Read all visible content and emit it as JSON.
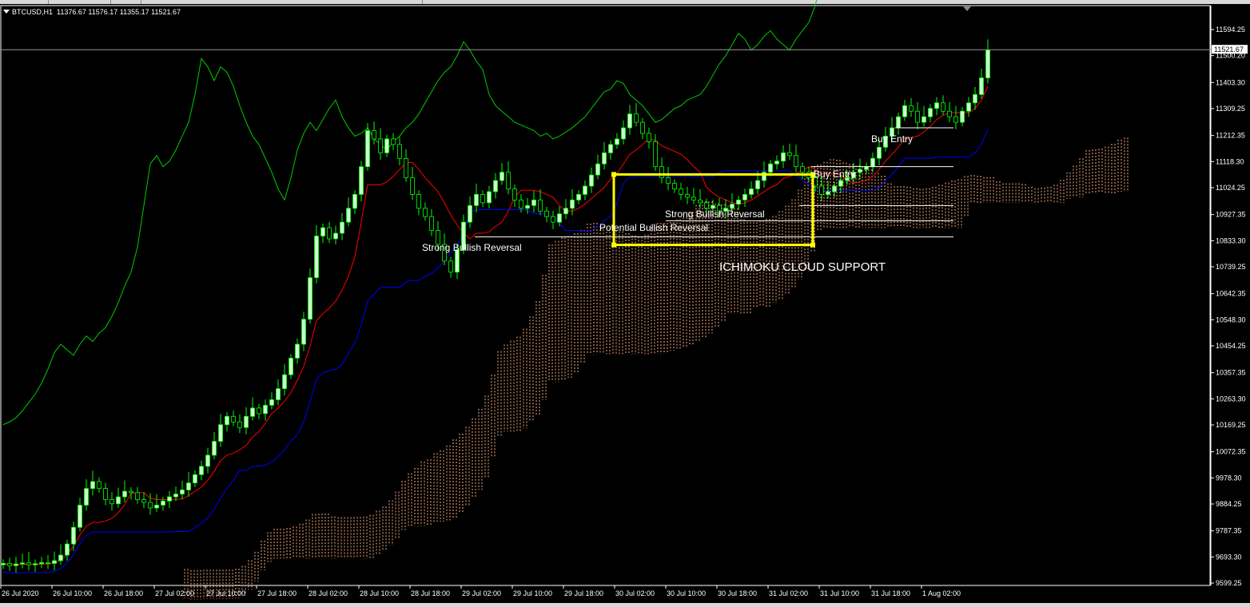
{
  "header": {
    "symbol": "BTCUSD,H1",
    "ohlc": "11376.67 11576.17 11355.17 11521.67"
  },
  "colors": {
    "background": "#000000",
    "bull_candle": "#ccffcc",
    "candle_wick": "#00ff00",
    "chikou": "#00cc00",
    "tenkan": "#ff0000",
    "kijun": "#0000ff",
    "cloud": "#ffb080",
    "highlight_box": "#ffff00",
    "level_line": "#ffffff"
  },
  "chart_data": {
    "type": "candlestick",
    "title": "BTCUSD,H1",
    "indicator": "Ichimoku",
    "current_price": "11521.67",
    "y_ticks": [
      "11594.25",
      "11500.20",
      "11403.30",
      "11309.25",
      "11212.35",
      "11118.30",
      "11024.25",
      "10927.35",
      "10833.30",
      "10739.25",
      "10642.35",
      "10548.30",
      "10454.25",
      "10357.35",
      "10263.30",
      "10169.25",
      "10072.35",
      "9978.30",
      "9884.25",
      "9787.35",
      "9693.30",
      "9599.25"
    ],
    "x_ticks": [
      "26 Jul 2020",
      "26 Jul 10:00",
      "26 Jul 18:00",
      "27 Jul 02:00",
      "27 Jul 10:00",
      "27 Jul 18:00",
      "28 Jul 02:00",
      "28 Jul 10:00",
      "28 Jul 18:00",
      "29 Jul 02:00",
      "29 Jul 10:00",
      "29 Jul 18:00",
      "30 Jul 02:00",
      "30 Jul 10:00",
      "30 Jul 18:00",
      "31 Jul 02:00",
      "31 Jul 10:00",
      "31 Jul 18:00",
      "1 Aug 02:00"
    ],
    "ylim": [
      9599.25,
      11594.25
    ],
    "grid": false,
    "annotations": [
      "Strong Bullish Reversal",
      "Strong Bullish Reversal",
      "Potential Bullish Reversal",
      "Buy Entry",
      "Buy Entry",
      "ICHIMOKU CLOUD SUPPORT"
    ],
    "levels": [
      10847,
      10905,
      10960,
      11100,
      11240
    ],
    "box": {
      "price_top": 11072,
      "price_bottom": 10818,
      "time_start": "30 Jul 02:00",
      "time_end": "31 Jul 04:00"
    },
    "closes": [
      9670,
      9662,
      9668,
      9672,
      9665,
      9669,
      9673,
      9670,
      9680,
      9700,
      9740,
      9800,
      9880,
      9940,
      9965,
      9940,
      9900,
      9885,
      9910,
      9930,
      9925,
      9900,
      9890,
      9870,
      9880,
      9895,
      9910,
      9920,
      9935,
      9960,
      9990,
      10020,
      10060,
      10110,
      10170,
      10200,
      10180,
      10160,
      10200,
      10230,
      10210,
      10240,
      10260,
      10300,
      10350,
      10410,
      10460,
      10550,
      10700,
      10850,
      10880,
      10840,
      10860,
      10900,
      10950,
      11000,
      11100,
      11230,
      11200,
      11150,
      11200,
      11180,
      11130,
      11060,
      11000,
      10950,
      10920,
      10870,
      10820,
      10760,
      10720,
      10800,
      10900,
      10960,
      11000,
      10970,
      11010,
      11050,
      11080,
      11020,
      10980,
      10950,
      10960,
      10980,
      10940,
      10920,
      10900,
      10930,
      10950,
      10980,
      11000,
      11030,
      11070,
      11110,
      11150,
      11180,
      11200,
      11240,
      11290,
      11260,
      11220,
      11190,
      11100,
      11060,
      11040,
      11020,
      11000,
      10990,
      10980,
      10970,
      10950,
      10960,
      10940,
      10950,
      10965,
      10980,
      11000,
      11020,
      11050,
      11080,
      11110,
      11120,
      11150,
      11140,
      11100,
      11080,
      11060,
      11030,
      11000,
      11010,
      11030,
      11050,
      11060,
      11080,
      11090,
      11100,
      11130,
      11170,
      11210,
      11240,
      11280,
      11320,
      11300,
      11260,
      11280,
      11310,
      11330,
      11300,
      11280,
      11260,
      11300,
      11330,
      11360,
      11420,
      11520
    ]
  }
}
